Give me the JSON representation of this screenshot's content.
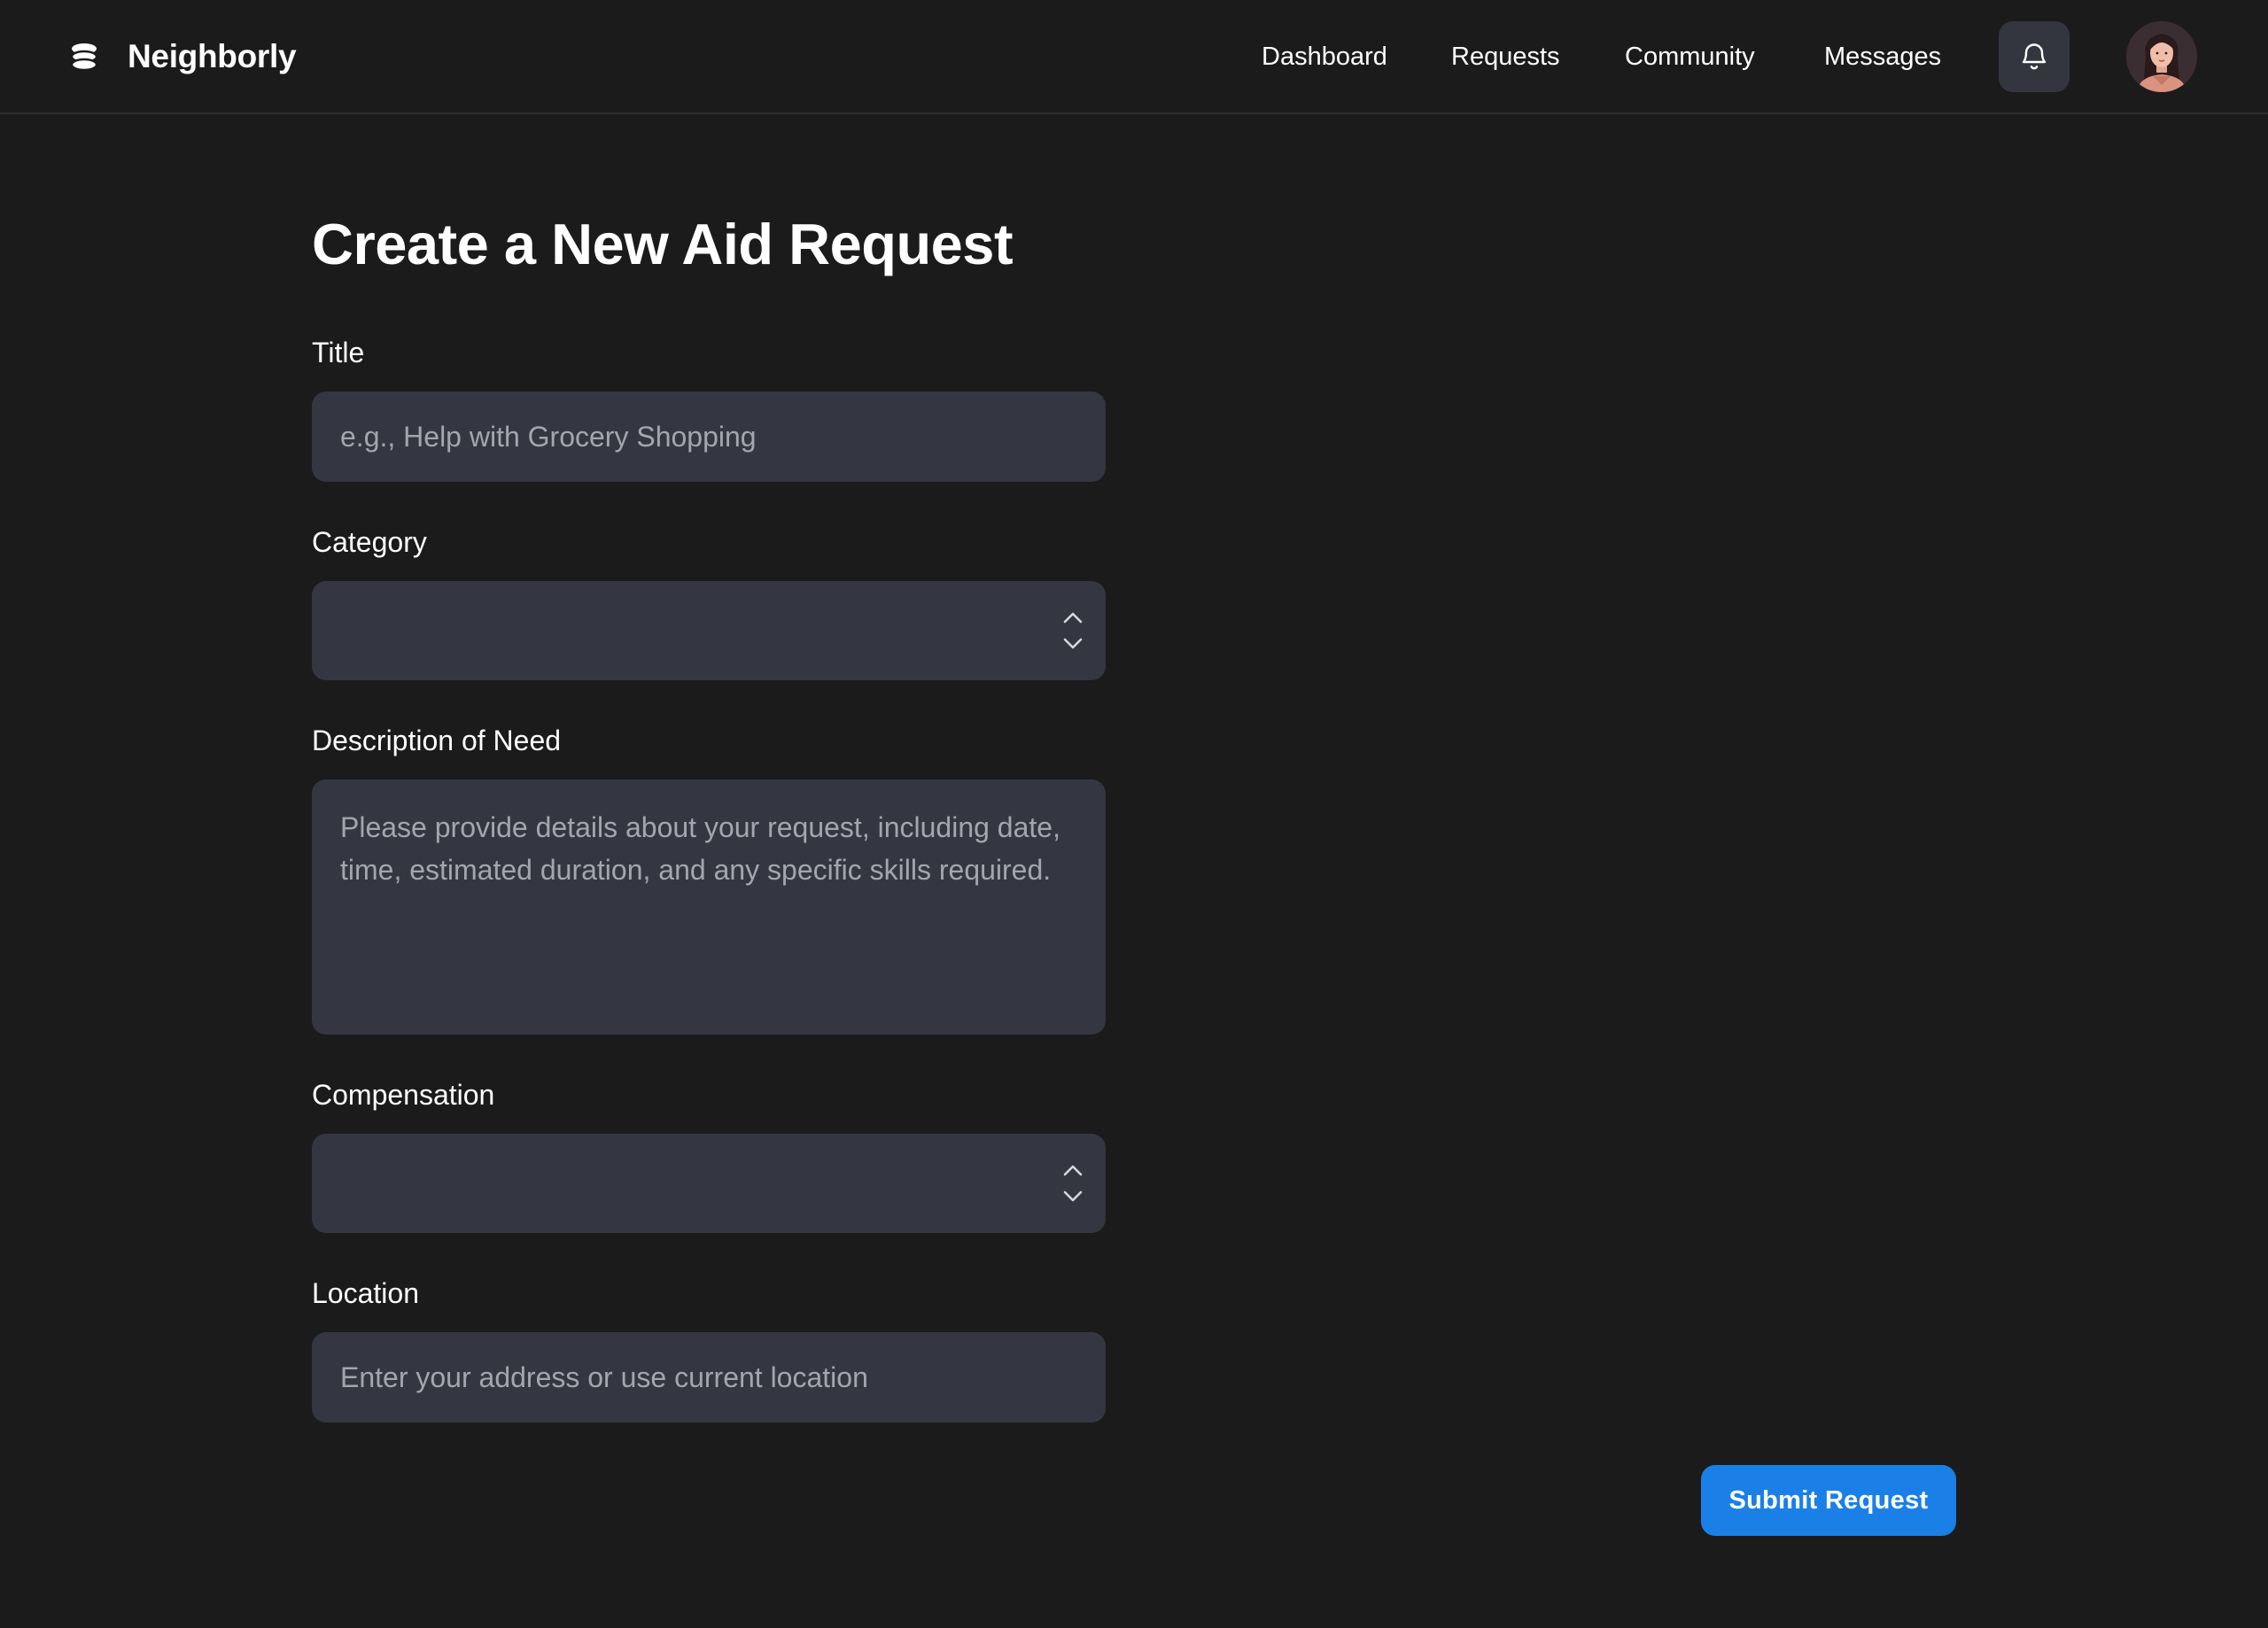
{
  "app": {
    "name": "Neighborly",
    "logo_icon": "stacked-layers-icon"
  },
  "nav": {
    "items": [
      {
        "label": "Dashboard"
      },
      {
        "label": "Requests"
      },
      {
        "label": "Community"
      },
      {
        "label": "Messages"
      }
    ],
    "notifications_icon": "bell-icon",
    "avatar_icon": "user-avatar"
  },
  "form": {
    "title": "Create a New Aid Request",
    "fields": {
      "title": {
        "label": "Title",
        "value": "",
        "placeholder": "e.g., Help with Grocery Shopping"
      },
      "category": {
        "label": "Category",
        "selected": ""
      },
      "description": {
        "label": "Description of Need",
        "value": "",
        "placeholder": "Please provide details about your request, including date, time, estimated duration, and any specific skills required."
      },
      "compensation": {
        "label": "Compensation",
        "selected": ""
      },
      "location": {
        "label": "Location",
        "value": "",
        "placeholder": "Enter your address or use current location"
      }
    },
    "submit_label": "Submit Request"
  },
  "colors": {
    "background": "#1b1b1c",
    "field_background": "#343741",
    "placeholder": "#a3a6ad",
    "accent": "#1a80e8",
    "divider": "#2e2f31"
  }
}
